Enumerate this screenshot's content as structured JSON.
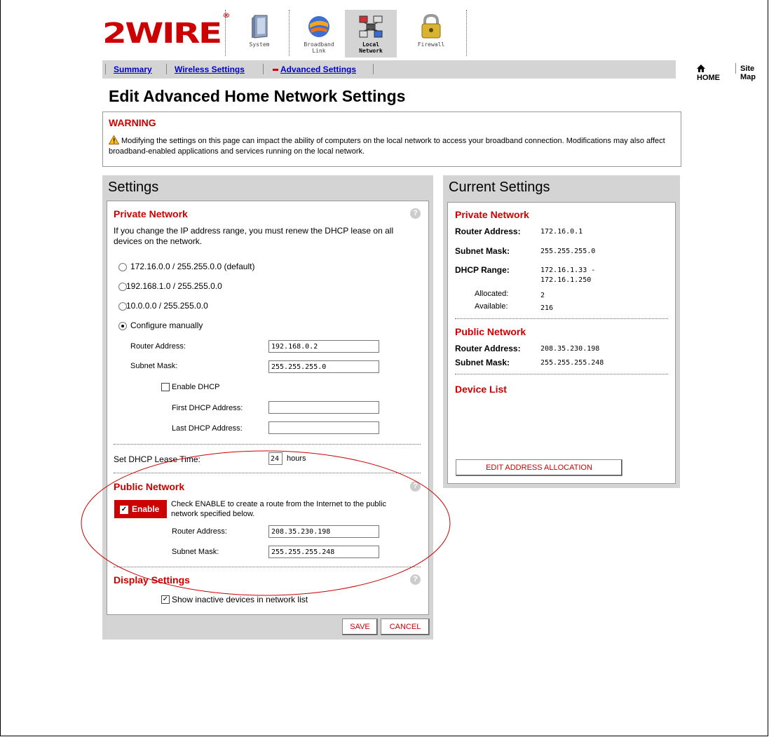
{
  "brand": {
    "logo_text": "2WIRE",
    "reg": "®"
  },
  "tabs": [
    {
      "label1": "",
      "label2": "System",
      "icon": "system-icon"
    },
    {
      "label1": "Broadband",
      "label2": "Link",
      "icon": "broadband-link-icon"
    },
    {
      "label1": "Local",
      "label2": "Network",
      "icon": "local-network-icon"
    },
    {
      "label1": "",
      "label2": "Firewall",
      "icon": "firewall-lock-icon"
    }
  ],
  "subnav": {
    "summary": "Summary",
    "wireless": "Wireless Settings",
    "advanced": "Advanced Settings",
    "home": "HOME",
    "sitemap": "Site Map"
  },
  "page_title": "Edit Advanced Home Network Settings",
  "warning": {
    "title": "WARNING",
    "text": "Modifying the settings on this page can impact the ability of computers on the local network to access your broadband connection. Modifications may also affect broadband-enabled applications and services running on the local network."
  },
  "settings": {
    "title": "Settings",
    "private_network": {
      "title": "Private Network",
      "help": "?",
      "intro": "If you change the IP address range, you must renew the DHCP lease on all devices on the network.",
      "options": [
        {
          "label": "172.16.0.0 / 255.255.0.0 (default)",
          "selected": false
        },
        {
          "label": "192.168.1.0 / 255.255.0.0",
          "selected": false
        },
        {
          "label": "10.0.0.0 / 255.255.0.0",
          "selected": false
        },
        {
          "label": "Configure manually",
          "selected": true
        }
      ],
      "router_address_label": "Router Address:",
      "router_address": "192.168.0.2",
      "subnet_mask_label": "Subnet Mask:",
      "subnet_mask": "255.255.255.0",
      "enable_dhcp_label": "Enable DHCP",
      "enable_dhcp": false,
      "first_dhcp_label": "First DHCP Address:",
      "first_dhcp": "",
      "last_dhcp_label": "Last DHCP Address:",
      "last_dhcp": "",
      "lease_label": "Set DHCP Lease Time:",
      "lease_value": "24",
      "lease_unit": "hours"
    },
    "public_network": {
      "title": "Public Network",
      "help": "?",
      "enable_label": "Enable",
      "enabled": true,
      "enable_desc": "Check ENABLE to create a route from the Internet to the public network specified below.",
      "router_address_label": "Router Address:",
      "router_address": "208.35.230.198",
      "subnet_mask_label": "Subnet Mask:",
      "subnet_mask": "255.255.255.248"
    },
    "display_settings": {
      "title": "Display Settings",
      "help": "?",
      "show_inactive_label": "Show inactive devices in network list",
      "show_inactive": true
    },
    "save": "SAVE",
    "cancel": "CANCEL"
  },
  "current": {
    "title": "Current Settings",
    "private_title": "Private Network",
    "router_label": "Router Address:",
    "router_value": "172.16.0.1",
    "mask_label": "Subnet Mask:",
    "mask_value": "255.255.255.0",
    "dhcp_label": "DHCP Range:",
    "dhcp_value1": "172.16.1.33 -",
    "dhcp_value2": "172.16.1.250",
    "allocated_label": "Allocated:",
    "allocated_value": "2",
    "available_label": "Available:",
    "available_value": "216",
    "public_title": "Public Network",
    "pub_router_label": "Router Address:",
    "pub_router_value": "208.35.230.198",
    "pub_mask_label": "Subnet Mask:",
    "pub_mask_value": "255.255.255.248",
    "device_list_title": "Device List",
    "edit_alloc": "EDIT ADDRESS ALLOCATION"
  }
}
